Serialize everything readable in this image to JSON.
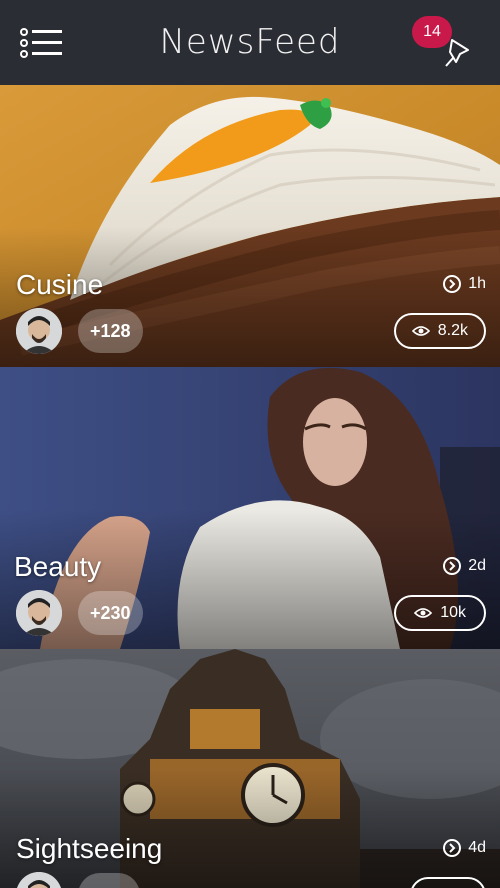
{
  "header": {
    "title": "NewsFeed",
    "notification_count": "14"
  },
  "feed": [
    {
      "category": "Cusine",
      "time": "1h",
      "participants": "+128",
      "views": "8.2k"
    },
    {
      "category": "Beauty",
      "time": "2d",
      "participants": "+230",
      "views": "10k"
    },
    {
      "category": "Sightseeing",
      "time": "4d",
      "participants": "",
      "views": ""
    }
  ],
  "colors": {
    "header_bg": "#2b2d34",
    "badge": "#c9184a",
    "accent": "#ffffff"
  },
  "icons": {
    "menu": "list-menu-icon",
    "pin": "pin-icon",
    "clock": "clock-icon",
    "views": "eye-icon"
  }
}
